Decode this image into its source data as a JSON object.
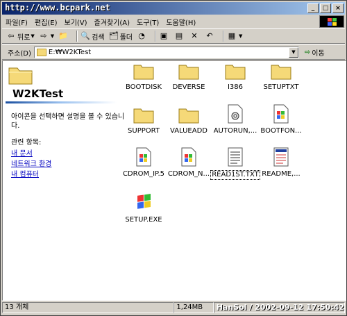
{
  "titlebar": {
    "watermark": "http://www.bcpark.net"
  },
  "menu": [
    "파일(F)",
    "편집(E)",
    "보기(V)",
    "즐겨찾기(A)",
    "도구(T)",
    "도움말(H)"
  ],
  "toolbar": {
    "back_label": "뒤로",
    "search_label": "검색",
    "folders_label": "폴더"
  },
  "address": {
    "label": "주소(D)",
    "path": "E:₩W2KTest",
    "go_label": "이동"
  },
  "side": {
    "title": "W2KTest",
    "description": "아이콘을 선택하면 설명을 볼 수 있습니다.",
    "related_label": "관련 항목:",
    "links": [
      "내 문서",
      "네트워크 환경",
      "내 컴퓨터"
    ]
  },
  "items": [
    {
      "label": "BOOTDISK",
      "type": "folder"
    },
    {
      "label": "DEVERSE",
      "type": "folder"
    },
    {
      "label": "I386",
      "type": "folder"
    },
    {
      "label": "SETUPTXT",
      "type": "folder"
    },
    {
      "label": "SUPPORT",
      "type": "folder"
    },
    {
      "label": "VALUEADD",
      "type": "folder"
    },
    {
      "label": "AUTORUN,...",
      "type": "inf"
    },
    {
      "label": "BOOTFON...",
      "type": "bin"
    },
    {
      "label": "CDROM_IP.5",
      "type": "bin"
    },
    {
      "label": "CDROM_N...",
      "type": "bin"
    },
    {
      "label": "READ1ST.TXT",
      "type": "txt"
    },
    {
      "label": "README,...",
      "type": "doc"
    },
    {
      "label": "SETUP.EXE",
      "type": "exe"
    }
  ],
  "status": {
    "count": "13 개체",
    "size": "1,24MB",
    "watermark": "HanSol / 2002-09-12 17:50:42"
  }
}
